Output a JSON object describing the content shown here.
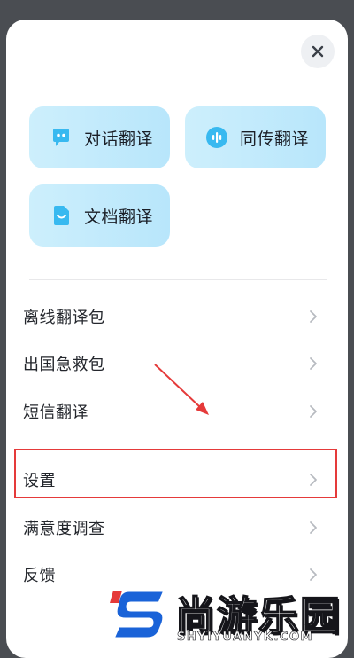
{
  "quick_actions": [
    {
      "label": "对话翻译",
      "icon": "chat-bubble-icon"
    },
    {
      "label": "同传翻译",
      "icon": "voice-wave-icon"
    },
    {
      "label": "文档翻译",
      "icon": "document-icon"
    }
  ],
  "menu": [
    {
      "label": "离线翻译包"
    },
    {
      "label": "出国急救包"
    },
    {
      "label": "短信翻译"
    },
    {
      "label": "设置"
    },
    {
      "label": "满意度调查"
    },
    {
      "label": "反馈"
    }
  ],
  "watermark": {
    "brand": "尚游乐园",
    "url": "SHYIYUANYK.COM"
  },
  "colors": {
    "accent": "#38b9f0",
    "card_bg": "#c6ecfc",
    "highlight_box": "#e53a3a",
    "annotation_arrow": "#e53a3a",
    "watermark_s": "#1a63d8"
  }
}
